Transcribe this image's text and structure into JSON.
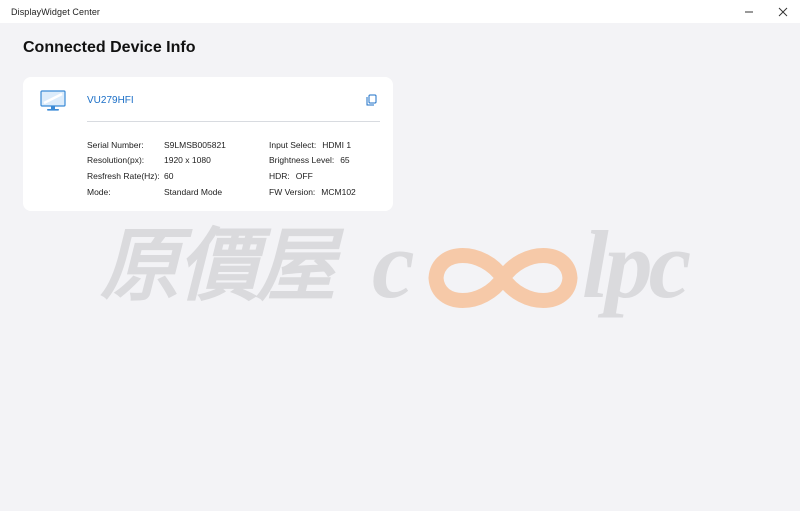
{
  "window": {
    "title": "DisplayWidget Center",
    "controls": [
      "minimize-icon",
      "close-icon"
    ]
  },
  "page": {
    "title": "Connected Device Info"
  },
  "device": {
    "icon": "monitor-icon",
    "name": "VU279HFI",
    "copy_icon": "copy-icon",
    "info_left": [
      {
        "label": "Serial Number:",
        "value": "S9LMSB005821"
      },
      {
        "label": "Resolution(px):",
        "value": "1920 x 1080"
      },
      {
        "label": "Resfresh Rate(Hz):",
        "value": "60"
      },
      {
        "label": "Mode:",
        "value": "Standard Mode"
      }
    ],
    "info_right": [
      {
        "label": "Input Select:",
        "value": "HDMI 1"
      },
      {
        "label": "Brightness Level:",
        "value": "65"
      },
      {
        "label": "HDR:",
        "value": "OFF"
      },
      {
        "label": "FW Version:",
        "value": "MCM102"
      }
    ]
  },
  "watermark": {
    "cjk": "原價屋",
    "c": "c",
    "lpc": "lpc"
  },
  "colors": {
    "accent": "#1b6fc7",
    "background": "#f3f3f6",
    "card": "#ffffff",
    "watermark_gray": "#dadadd",
    "watermark_orange": "#f6c9a8"
  }
}
